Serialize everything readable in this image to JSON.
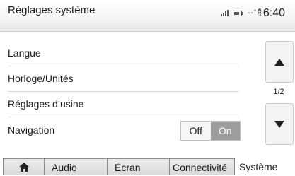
{
  "header": {
    "title": "Réglages système",
    "temperature": "--°F",
    "clock": "16:40"
  },
  "settings": [
    {
      "label": "Langue"
    },
    {
      "label": "Horloge/Unités"
    },
    {
      "label": "Réglages d’usine"
    },
    {
      "label": "Navigation"
    }
  ],
  "navigation_toggle": {
    "off_label": "Off",
    "on_label": "On",
    "selected": "On"
  },
  "scroll": {
    "page_indicator": "1/2"
  },
  "tabs": [
    {
      "label": "",
      "icon": "home-icon"
    },
    {
      "label": "Audio"
    },
    {
      "label": "Écran"
    },
    {
      "label": "Connectivité"
    },
    {
      "label": "Système",
      "active": true
    }
  ],
  "colors": {
    "toggle_on": "#9d9d9d",
    "header_bg": "#f4f4f4",
    "tab_bg": "#dcdcdc"
  }
}
